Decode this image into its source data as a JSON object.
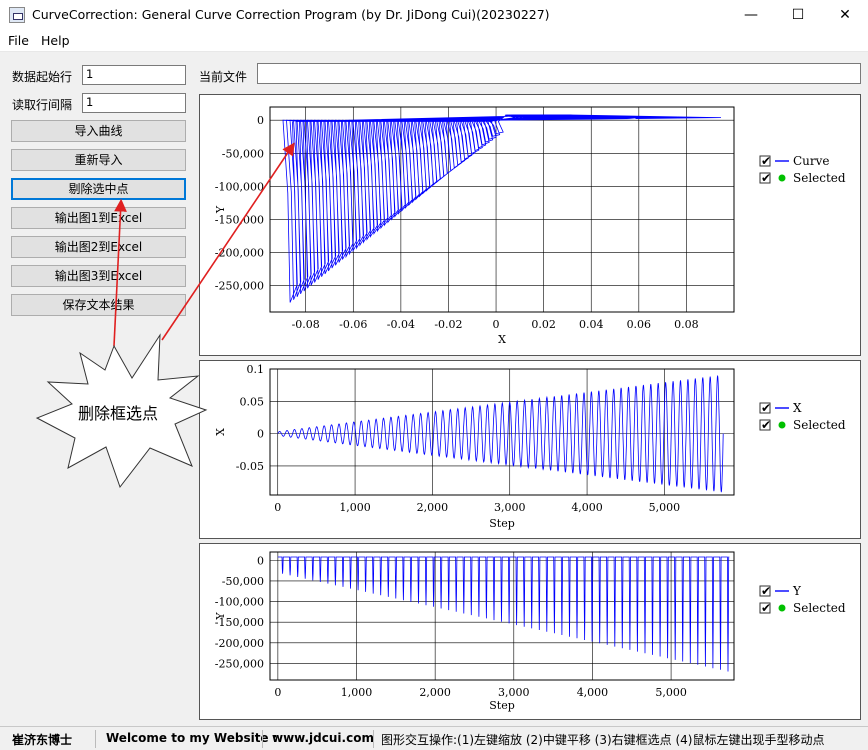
{
  "window": {
    "title": "CurveCorrection: General Curve Correction Program (by Dr. JiDong Cui)(20230227)",
    "min_glyph": "—",
    "max_glyph": "☐",
    "close_glyph": "✕"
  },
  "menu": {
    "file": "File",
    "help": "Help"
  },
  "form": {
    "start_row_label": "数据起始行",
    "start_row_value": "1",
    "interval_label": "读取行间隔",
    "interval_value": "1",
    "current_file_label": "当前文件",
    "current_file_value": ""
  },
  "buttons": {
    "import": "导入曲线",
    "reimport": "重新导入",
    "remove_selected": "剔除选中点",
    "export1": "输出图1到Excel",
    "export2": "输出图2到Excel",
    "export3": "输出图3到Excel",
    "save_text": "保存文本结果"
  },
  "annotation": {
    "callout": "删除框选点"
  },
  "colors": {
    "curve": "#0000ff",
    "selected": "#00c000",
    "focus": "#0078d7",
    "arrow": "#e02020"
  },
  "charts": [
    {
      "name": "Y vs X",
      "ylabel": "Y",
      "xlabel": "X",
      "yticks": [
        "0",
        "-50,000",
        "-100,000",
        "-150,000",
        "-200,000",
        "-250,000"
      ],
      "xticks": [
        "-0.08",
        "-0.06",
        "-0.04",
        "-0.02",
        "0",
        "0.02",
        "0.04",
        "0.06",
        "0.08"
      ],
      "legend": [
        {
          "label": "Curve",
          "checked": true
        },
        {
          "label": "Selected",
          "checked": true
        }
      ]
    },
    {
      "name": "X vs Step",
      "ylabel": "X",
      "xlabel": "Step",
      "yticks": [
        "0.1",
        "0.05",
        "0",
        "-0.05"
      ],
      "xticks": [
        "0",
        "1,000",
        "2,000",
        "3,000",
        "4,000",
        "5,000"
      ],
      "legend": [
        {
          "label": "X",
          "checked": true
        },
        {
          "label": "Selected",
          "checked": true
        }
      ]
    },
    {
      "name": "Y vs Step",
      "ylabel": "Y",
      "xlabel": "Step",
      "yticks": [
        "0",
        "-50,000",
        "-100,000",
        "-150,000",
        "-200,000",
        "-250,000"
      ],
      "xticks": [
        "0",
        "1,000",
        "2,000",
        "3,000",
        "4,000",
        "5,000"
      ],
      "legend": [
        {
          "label": "Y",
          "checked": true
        },
        {
          "label": "Selected",
          "checked": true
        }
      ]
    }
  ],
  "chart_data": [
    {
      "type": "line",
      "xlabel": "X",
      "ylabel": "Y",
      "xlim": [
        -0.095,
        0.1
      ],
      "ylim": [
        -290000,
        20000
      ],
      "series": [
        {
          "name": "Curve"
        },
        {
          "name": "Selected",
          "values": []
        }
      ]
    },
    {
      "type": "line",
      "xlabel": "Step",
      "ylabel": "X",
      "xlim": [
        -100,
        5900
      ],
      "ylim": [
        -0.095,
        0.1
      ],
      "series": [
        {
          "name": "X"
        },
        {
          "name": "Selected",
          "values": []
        }
      ]
    },
    {
      "type": "line",
      "xlabel": "Step",
      "ylabel": "Y",
      "xlim": [
        -100,
        5800
      ],
      "ylim": [
        -290000,
        20000
      ],
      "series": [
        {
          "name": "Y"
        },
        {
          "name": "Selected",
          "values": []
        }
      ]
    }
  ],
  "status": {
    "author": "崔济东博士",
    "welcome": "Welcome to my Website :",
    "website": "www.jdcui.com",
    "help": "图形交互操作:(1)左键缩放 (2)中键平移 (3)右键框选点 (4)鼠标左键出现手型移动点"
  }
}
